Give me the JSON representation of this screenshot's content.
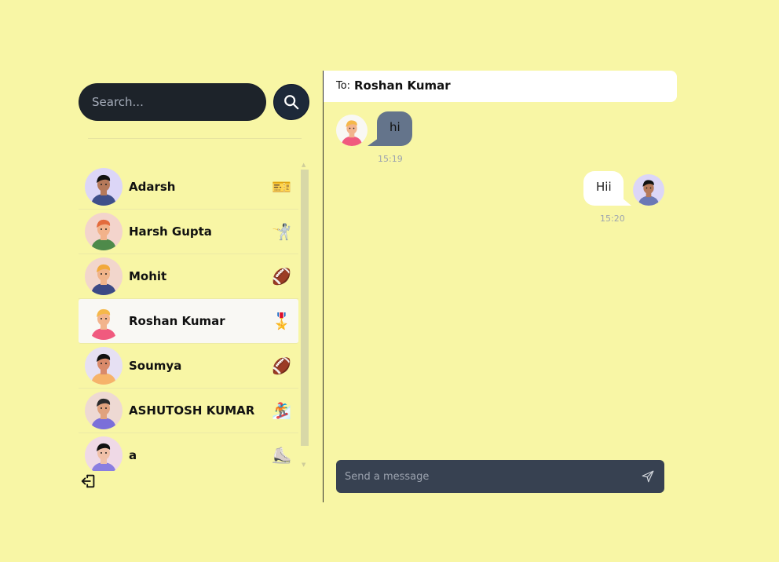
{
  "search": {
    "placeholder": "Search..."
  },
  "contacts": [
    {
      "name": "Adarsh",
      "emoji": "🎫",
      "avatar_bg": "#dcd6f7",
      "skin": "#b5795a",
      "hair": "#111111",
      "shirt": "#3f4f8a"
    },
    {
      "name": "Harsh Gupta",
      "emoji": "🤺",
      "avatar_bg": "#f3d4cc",
      "skin": "#f2b28a",
      "hair": "#e36b3d",
      "shirt": "#4e8a4a"
    },
    {
      "name": "Mohit",
      "emoji": "🏈",
      "avatar_bg": "#f2d6cc",
      "skin": "#f0b48a",
      "hair": "#f2a93b",
      "shirt": "#3c4a85"
    },
    {
      "name": "Roshan Kumar",
      "emoji": "🎖️",
      "avatar_bg": "#f9f8f4",
      "skin": "#f2b48c",
      "hair": "#f5b84a",
      "shirt": "#f05a7e"
    },
    {
      "name": "Soumya",
      "emoji": "🏈",
      "avatar_bg": "#e6e0f3",
      "skin": "#d98a6a",
      "hair": "#111111",
      "shirt": "#f6b36a"
    },
    {
      "name": "ASHUTOSH KUMAR",
      "emoji": "🏂",
      "avatar_bg": "#eed9d3",
      "skin": "#e0a27e",
      "hair": "#2b2b2b",
      "shirt": "#7b6fd9"
    },
    {
      "name": "a",
      "emoji": "⛸️",
      "avatar_bg": "#efd9e6",
      "skin": "#f0c0a8",
      "hair": "#111111",
      "shirt": "#8a7ee0"
    }
  ],
  "active_contact_index": 3,
  "chat": {
    "to_label": "To:",
    "to_name": "Roshan Kumar",
    "messages": [
      {
        "text": "hi",
        "time": "15:19",
        "direction": "incoming"
      },
      {
        "text": "Hii",
        "time": "15:20",
        "direction": "outgoing"
      }
    ],
    "input_placeholder": "Send a message"
  },
  "colors": {
    "background": "#f8f6a5",
    "search_bg": "#1d232a",
    "incoming_bubble": "#64748b",
    "outgoing_bubble": "#ffffff",
    "message_box": "#374151"
  },
  "icons": {
    "search": "search-icon",
    "logout": "logout-icon",
    "send": "send-icon"
  }
}
